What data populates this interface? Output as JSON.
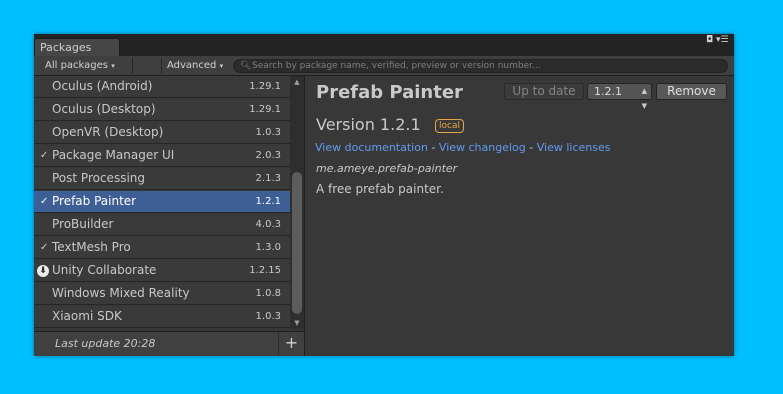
{
  "window": {
    "tab_label": "Packages",
    "ctl_maximize": "◘",
    "ctl_menu": "▾☰"
  },
  "toolbar": {
    "filter_label": "All packages",
    "advanced_label": "Advanced",
    "search_placeholder": "Search by package name, verified, preview or version number...",
    "search_icon": "search-icon",
    "dropdown_glyph": "▾"
  },
  "packages": [
    {
      "name": "Oculus (Android)",
      "version": "1.29.1",
      "state": "none"
    },
    {
      "name": "Oculus (Desktop)",
      "version": "1.29.1",
      "state": "none"
    },
    {
      "name": "OpenVR (Desktop)",
      "version": "1.0.3",
      "state": "none"
    },
    {
      "name": "Package Manager UI",
      "version": "2.0.3",
      "state": "installed"
    },
    {
      "name": "Post Processing",
      "version": "2.1.3",
      "state": "none"
    },
    {
      "name": "Prefab Painter",
      "version": "1.2.1",
      "state": "installed",
      "selected": true
    },
    {
      "name": "ProBuilder",
      "version": "4.0.3",
      "state": "none"
    },
    {
      "name": "TextMesh Pro",
      "version": "1.3.0",
      "state": "installed"
    },
    {
      "name": "Unity Collaborate",
      "version": "1.2.15",
      "state": "download"
    },
    {
      "name": "Windows Mixed Reality",
      "version": "1.0.8",
      "state": "none"
    },
    {
      "name": "Xiaomi SDK",
      "version": "1.0.3",
      "state": "none"
    }
  ],
  "glyphs": {
    "check": "✓",
    "download": "⬇",
    "scroll_up": "▲",
    "scroll_down": "▼",
    "plus": "+"
  },
  "footer": {
    "status": "Last update 20:28"
  },
  "details": {
    "title": "Prefab Painter",
    "status_button": "Up to date",
    "selected_version": "1.2.1",
    "remove_button": "Remove",
    "version_line": "Version 1.2.1",
    "badge": "local",
    "link_documentation": "View documentation",
    "link_changelog": "View changelog",
    "link_licenses": "View licenses",
    "link_separator": "-",
    "package_id": "me.ameye.prefab-painter",
    "description": "A free prefab painter."
  },
  "colors": {
    "background": "#00BFFF",
    "window": "#383838",
    "selection": "#3e5f96",
    "link": "#5f9df0",
    "badge": "#e7a54a"
  }
}
